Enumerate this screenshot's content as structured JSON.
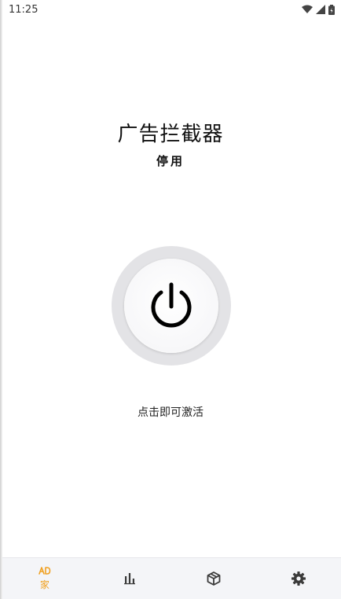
{
  "status_bar": {
    "time": "11:25",
    "icons": [
      "wifi-icon",
      "signal-icon",
      "battery-icon"
    ]
  },
  "main": {
    "title": "广告拦截器",
    "status": "停用",
    "hint": "点击即可激活",
    "power_icon": "power-icon"
  },
  "bottom_nav": {
    "items": [
      {
        "icon": "ad-home-icon",
        "label": "家",
        "active": true
      },
      {
        "icon": "bar-chart-icon",
        "label": ""
      },
      {
        "icon": "package-icon",
        "label": ""
      },
      {
        "icon": "gear-icon",
        "label": ""
      }
    ]
  },
  "colors": {
    "accent": "#f0a020",
    "nav_background": "#f4f5f8",
    "power_ring": "#e3e3e6"
  }
}
